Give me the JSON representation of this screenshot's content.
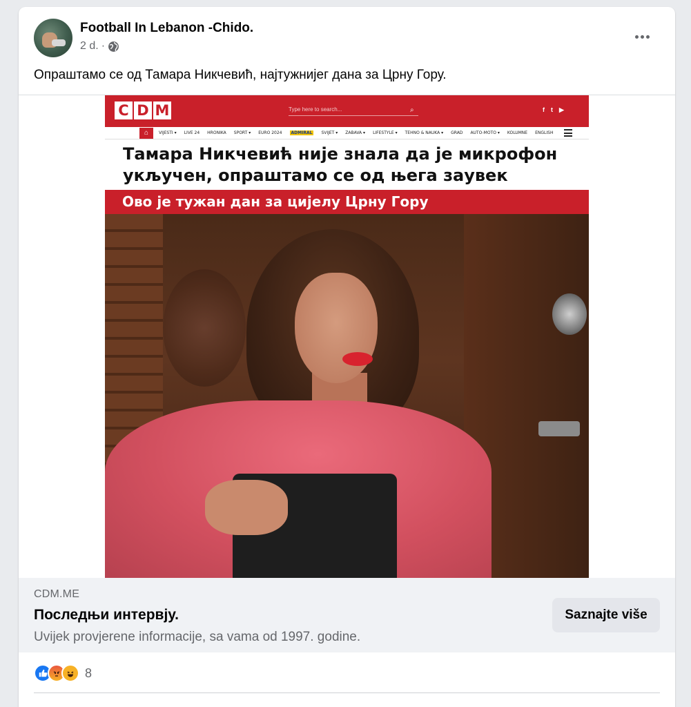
{
  "post": {
    "page_name": "Football In Lebanon -Chido.",
    "time": "2 d.",
    "separator": "·",
    "text": "Опраштамо се од Тамара Никчевић, најтужнијег дана за Црну Гору."
  },
  "article_image": {
    "logo_letters": [
      "C",
      "D",
      "M"
    ],
    "search_placeholder": "Type here to search...",
    "social": [
      "f",
      "t",
      "▶"
    ],
    "nav_items": [
      "VIJESTI ▾",
      "LIVE 24",
      "HRONIKA",
      "SPORT ▾",
      "EURO 2024",
      "ADMIRAL",
      "SVIJET ▾",
      "ZABAVA ▾",
      "LIFESTYLE ▾",
      "TEHNO & NAUKA ▾",
      "GRAD",
      "AUTO-MOTO ▾",
      "KOLUMNE",
      "ENGLISH"
    ],
    "headline": "Тамара Никчевић није знала да је микрофон укључен, опраштамо се од њега заувек",
    "subhead": "Ово је тужан дан за цијелу Црну Гору",
    "brand_color": "#c9202a"
  },
  "link_preview": {
    "domain": "CDM.ME",
    "title": "Последњи интервју.",
    "description": "Uvijek provjerene informacije, sa vama od 1997. godine.",
    "cta_label": "Saznajte više"
  },
  "reactions": {
    "types": [
      "like-icon",
      "angry-icon",
      "haha-icon"
    ],
    "count": "8"
  }
}
